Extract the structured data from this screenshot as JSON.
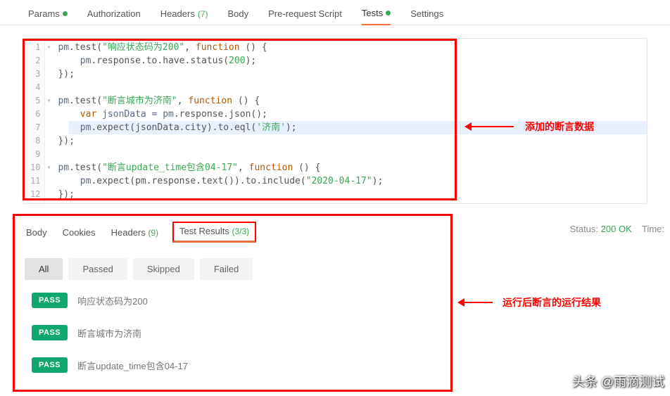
{
  "tabs": {
    "params": "Params",
    "authorization": "Authorization",
    "headers": "Headers",
    "headers_count": "(7)",
    "body": "Body",
    "prerequest": "Pre-request Script",
    "tests": "Tests",
    "settings": "Settings"
  },
  "editor": {
    "lines": {
      "n1": "1",
      "n2": "2",
      "n3": "3",
      "n4": "4",
      "n5": "5",
      "n6": "6",
      "n7": "7",
      "n8": "8",
      "n9": "9",
      "n10": "10",
      "n11": "11",
      "n12": "12"
    },
    "code": {
      "l1a": "pm",
      "l1b": ".test(",
      "l1c": "\"响应状态码为200\"",
      "l1d": ", ",
      "l1e": "function",
      "l1f": " () {",
      "l2a": "    pm",
      "l2b": ".response.to.have.status(",
      "l2c": "200",
      "l2d": ");",
      "l3": "});",
      "l5a": "pm",
      "l5b": ".test(",
      "l5c": "\"断言城市为济南\"",
      "l5d": ", ",
      "l5e": "function",
      "l5f": " () {",
      "l6a": "    ",
      "l6b": "var",
      "l6c": " jsonData = pm",
      "l6d": ".response.json();",
      "l7a": "    pm",
      "l7b": ".expect(jsonData.city).to.eql(",
      "l7c": "'济南'",
      "l7d": ");",
      "l8": "});",
      "l10a": "pm",
      "l10b": ".test(",
      "l10c": "\"断言update_time包含04-17\"",
      "l10d": ", ",
      "l10e": "function",
      "l10f": " () {",
      "l11a": "    pm",
      "l11b": ".expect(pm.response.text()).to.include(",
      "l11c": "\"2020-04-17\"",
      "l11d": ");",
      "l12": "});"
    }
  },
  "annotations": {
    "a1": "添加的断言数据",
    "a2": "运行后断言的运行结果"
  },
  "response": {
    "tabs": {
      "body": "Body",
      "cookies": "Cookies",
      "headers": "Headers",
      "headers_count": "(9)",
      "test_results": "Test Results",
      "tr_count": "(3/3)"
    },
    "filters": {
      "all": "All",
      "passed": "Passed",
      "skipped": "Skipped",
      "failed": "Failed"
    },
    "pass_label": "PASS",
    "results": {
      "r1": "响应状态码为200",
      "r2": "断言城市为济南",
      "r3": "断言update_time包含04-17"
    },
    "status_label": "Status:",
    "status_value": "200 OK",
    "time_label": "Time:"
  },
  "watermark": "头条 @雨滴测试"
}
